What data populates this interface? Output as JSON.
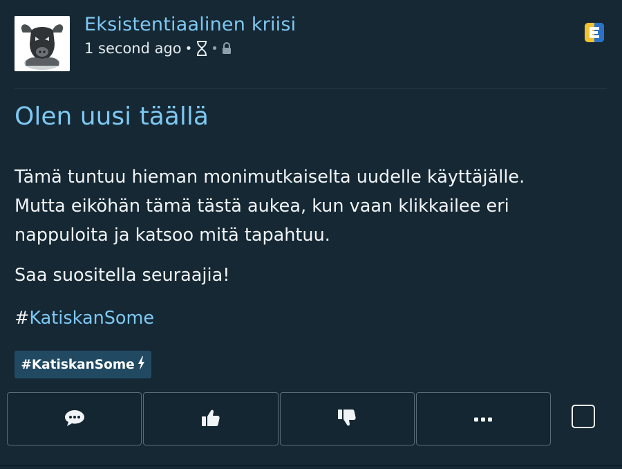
{
  "post": {
    "author_name": "Eksistentiaalinen kriisi",
    "timestamp": "1 second ago",
    "separator": "•",
    "meta_icons": [
      "hourglass-icon",
      "lock-icon"
    ],
    "title": "Olen uusi täällä",
    "body_lines": [
      "Tämä tuntuu hieman monimutkaiselta uudelle käyttäjälle.",
      "Mutta eiköhän tämä tästä aukea, kun vaan klikkailee eri",
      "nappuloita ja katsoo mitä tapahtuu."
    ],
    "body_paragraph_2": "Saa suositella seuraajia!",
    "hashtag_prefix": "#",
    "hashtag_text": "KatiskanSome",
    "tag_chip_label": "#KatiskanSome"
  },
  "actions": [
    {
      "name": "comment-button",
      "icon": "comment-icon"
    },
    {
      "name": "like-button",
      "icon": "thumbs-up-icon"
    },
    {
      "name": "dislike-button",
      "icon": "thumbs-down-icon"
    },
    {
      "name": "more-button",
      "icon": "ellipsis-icon"
    }
  ],
  "colors": {
    "background": "#152834",
    "link": "#7ec8f2",
    "text": "#f1f4f6",
    "chip": "#214a62",
    "badge_yellow": "#f2c230",
    "badge_blue": "#2b71c8"
  }
}
